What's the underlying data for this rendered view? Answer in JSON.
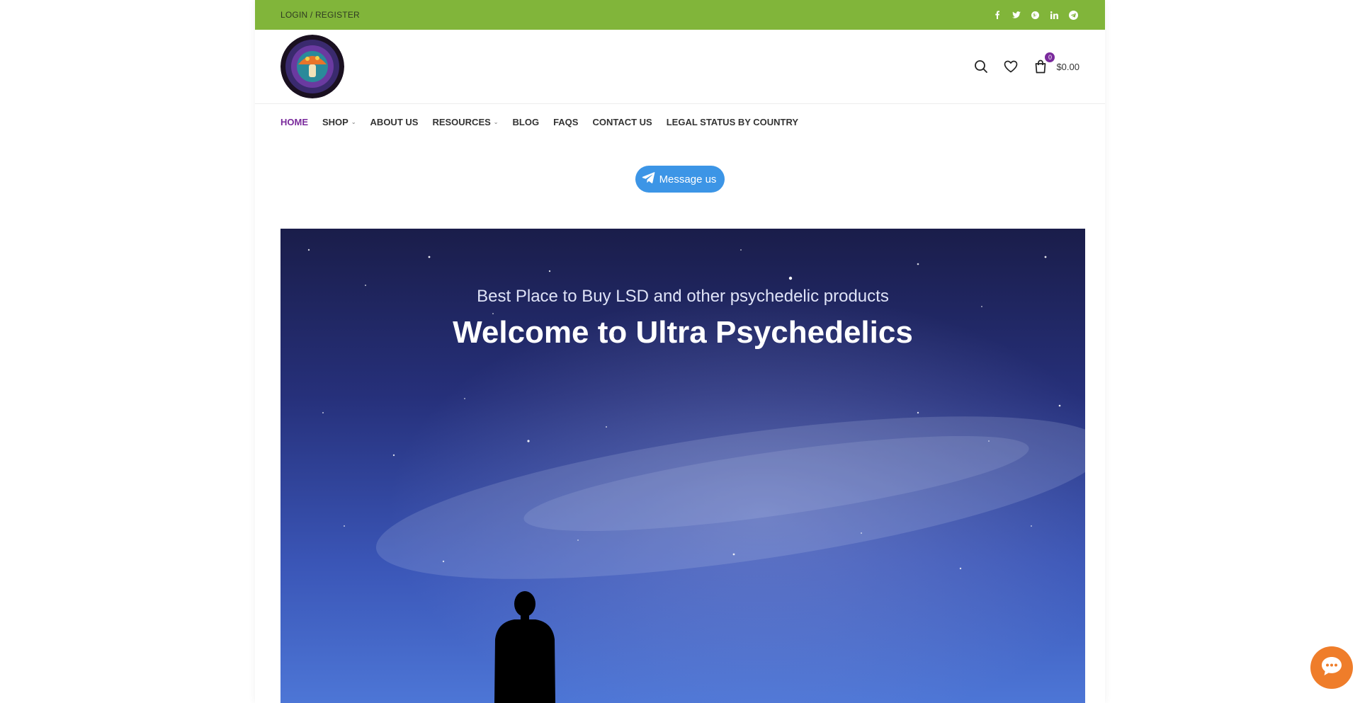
{
  "topbar": {
    "login_label": "LOGIN / REGISTER",
    "socials": [
      "facebook-icon",
      "twitter-icon",
      "pinterest-icon",
      "linkedin-icon",
      "telegram-icon"
    ]
  },
  "header": {
    "cart": {
      "count": "0",
      "total": "$0.00"
    }
  },
  "nav": {
    "items": [
      {
        "label": "HOME",
        "active": true
      },
      {
        "label": "SHOP",
        "dropdown": true
      },
      {
        "label": "ABOUT US"
      },
      {
        "label": "RESOURCES",
        "dropdown": true
      },
      {
        "label": "BLOG"
      },
      {
        "label": "FAQS"
      },
      {
        "label": "CONTACT US"
      },
      {
        "label": "LEGAL STATUS BY COUNTRY"
      }
    ]
  },
  "message_button": {
    "label": "Message us"
  },
  "hero": {
    "subtitle": "Best Place to Buy LSD and other psychedelic products",
    "title": "Welcome to Ultra Psychedelics"
  },
  "colors": {
    "topbar": "#81b53a",
    "accent": "#7a2a9c",
    "message_button": "#3c95e6",
    "chat_bubble": "#ef7d2a"
  }
}
